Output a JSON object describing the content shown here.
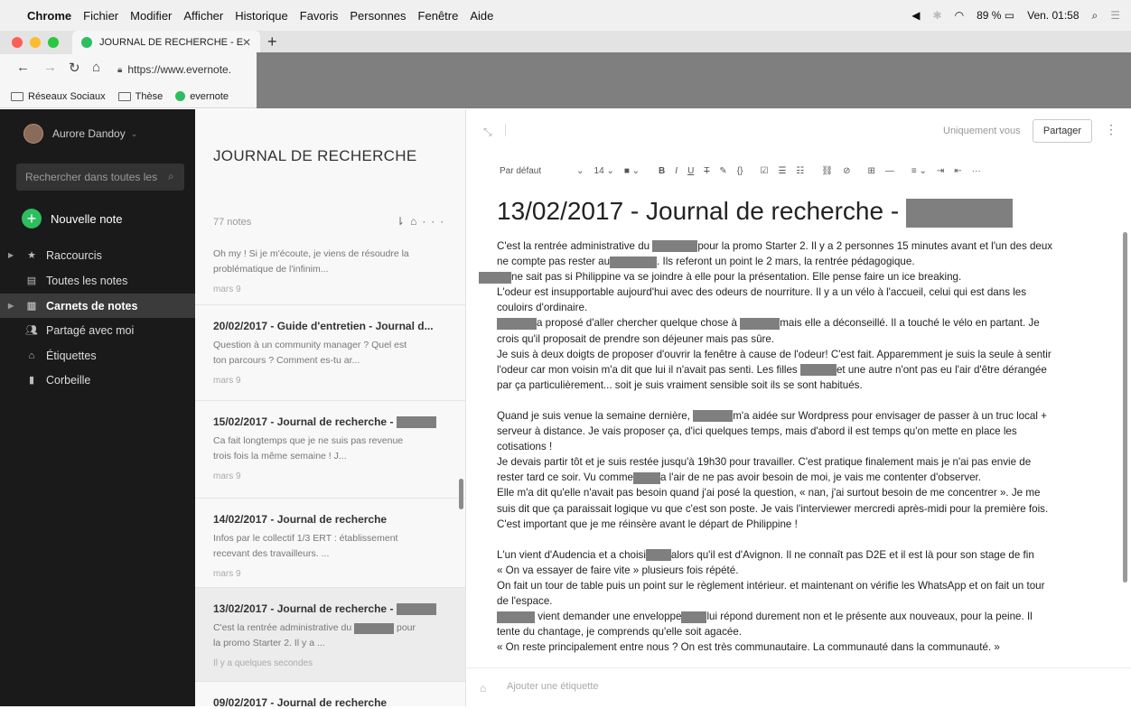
{
  "menubar": {
    "app": "Chrome",
    "items": [
      "Fichier",
      "Modifier",
      "Afficher",
      "Historique",
      "Favoris",
      "Personnes",
      "Fenêtre",
      "Aide"
    ],
    "battery": "89 %",
    "clock": "Ven. 01:58"
  },
  "browser": {
    "tab_title": "JOURNAL DE RECHERCHE - E",
    "url": "https://www.evernote.",
    "bookmarks": [
      "Réseaux Sociaux",
      "Thèse",
      "evernote"
    ]
  },
  "sidebar": {
    "user": "Aurore Dandoy",
    "search_placeholder": "Rechercher dans toutes les",
    "new_note": "Nouvelle note",
    "items": [
      {
        "label": "Raccourcis",
        "icon": "star-icon"
      },
      {
        "label": "Toutes les notes",
        "icon": "notes-icon"
      },
      {
        "label": "Carnets de notes",
        "icon": "notebook-icon"
      },
      {
        "label": "Partagé avec moi",
        "icon": "people-icon"
      },
      {
        "label": "Étiquettes",
        "icon": "tag-icon"
      },
      {
        "label": "Corbeille",
        "icon": "trash-icon"
      }
    ]
  },
  "notelist": {
    "title": "JOURNAL DE RECHERCHE",
    "count": "77 notes",
    "notes": [
      {
        "title": "",
        "snippet1": "Oh my !  Si je m'écoute, je viens de résoudre la",
        "snippet2": "problématique de l'infinim...",
        "date": "mars 9"
      },
      {
        "title": "20/02/2017 - Guide d'entretien - Journal d...",
        "snippet1": "Question à un community manager ? Quel est",
        "snippet2": "ton parcours ?  Comment es-tu ar...",
        "date": "mars 9"
      },
      {
        "title": "15/02/2017 - Journal de recherche - ",
        "snippet1": "Ca fait longtemps que je ne suis pas revenue",
        "snippet2": "trois fois la même semaine ! J...",
        "date": "mars 9"
      },
      {
        "title": "14/02/2017 - Journal de recherche",
        "snippet1": "Infos par le collectif 1/3  ERT : établissement",
        "snippet2": "recevant des travailleurs. ...",
        "date": "mars 9"
      },
      {
        "title": "13/02/2017 - Journal de recherche - ",
        "snippet1": "C'est la rentrée administrative du ",
        "snippet1b": " pour",
        "snippet2": "la promo Starter 2. Il y a ...",
        "date": "Il y a quelques secondes"
      },
      {
        "title": "09/02/2017 - Journal de recherche",
        "snippet1": "",
        "snippet2": "",
        "date": ""
      }
    ]
  },
  "editor": {
    "share_scope": "Uniquement vous",
    "share_button": "Partager",
    "toolbar": {
      "style": "Par défaut",
      "size": "14"
    },
    "note_title": "13/02/2017 - Journal de recherche - ",
    "tag_placeholder": "Ajouter une étiquette",
    "body": {
      "l1a": "C'est la rentrée administrative du ",
      "l1b": "pour la promo Starter 2. Il y a 2 personnes 15 minutes avant et l'un des deux",
      "l2a": "ne compte pas rester au",
      "l2b": ". Ils referont un point le 2 mars, la rentrée pédagogique.",
      "l3": "ne sait pas si Philippine va se joindre à elle pour la présentation. Elle pense faire un ice breaking.",
      "l4": "L'odeur est insupportable aujourd'hui avec des odeurs de nourriture. Il y a un vélo à l'accueil, celui qui est dans les",
      "l5": "couloirs d'ordinaire.",
      "l6a": "a proposé d'aller chercher quelque chose à ",
      "l6b": "mais elle a déconseillé. Il a touché le vélo en partant. Je",
      "l7": "crois qu'il proposait de prendre son déjeuner mais pas sûre.",
      "l8": "Je suis à deux doigts de proposer d'ouvrir la fenêtre à cause de l'odeur! C'est fait. Apparemment je suis la seule à sentir",
      "l9a": "l'odeur car mon voisin m'a dit que lui il n'avait pas senti. Les filles ",
      "l9b": "et une autre n'ont pas eu l'air d'être dérangée",
      "l10": "par ça particulièrement... soit je suis vraiment sensible soit ils se sont habitués.",
      "l11a": "Quand je suis venue la semaine dernière, ",
      "l11b": "m'a aidée sur Wordpress pour envisager de passer à un truc local +",
      "l12": "serveur à distance. Je vais proposer ça, d'ici quelques temps, mais d'abord il est temps qu'on mette en place les",
      "l13": "cotisations !",
      "l14": "Je devais partir tôt et je suis restée jusqu'à 19h30 pour travailler. C'est pratique finalement mais je n'ai pas envie de",
      "l15a": "rester tard ce soir. Vu comme",
      "l15b": "a l'air de ne pas avoir besoin de moi, je vais me contenter d'observer.",
      "l16": "Elle m'a dit qu'elle n'avait pas besoin quand j'ai posé la question, « nan, j'ai surtout besoin de me concentrer ». Je me",
      "l17": "suis dit que ça paraissait logique vu que c'est son poste. Je vais l'interviewer mercredi après-midi pour la première fois.",
      "l18": "C'est important que je me réinsère avant le départ de Philippine !",
      "l19a": "L'un vient d'Audencia et a choisi",
      "l19b": "alors qu'il est d'Avignon. Il ne connaît pas D2E et il est là pour son stage de fin",
      "l20": "« On va essayer de faire vite » plusieurs fois répété.",
      "l21": "On fait un tour de table puis un point sur le règlement intérieur. et maintenant on vérifie les WhatsApp et on fait un tour",
      "l22": "de l'espace.",
      "l23a": "vient demander une enveloppe",
      "l23b": "lui répond durement non et le présente aux nouveaux, pour la peine. Il",
      "l24": "tente du chantage, je comprends qu'elle soit agacée.",
      "l25": "« On reste principalement entre nous ? On est très communautaire. La communauté dans la communauté. »"
    }
  }
}
